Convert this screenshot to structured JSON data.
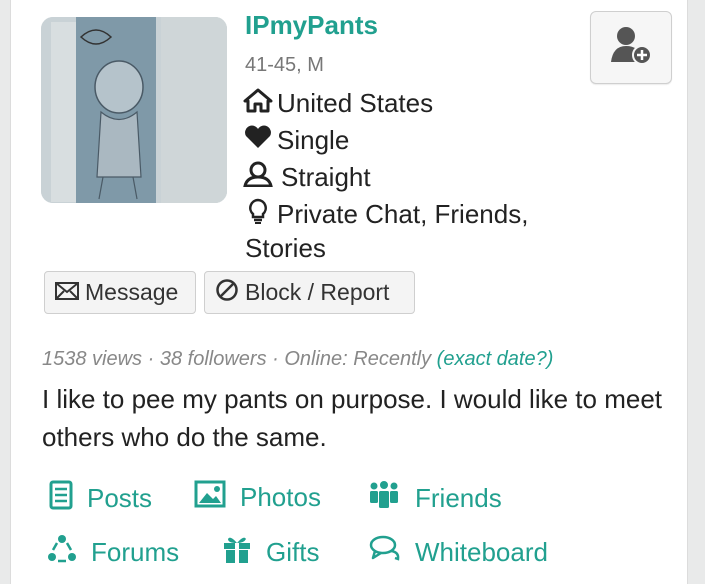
{
  "profile": {
    "username": "IPmyPants",
    "age_gender": "41-45, M",
    "location": "United States",
    "relationship": "Single",
    "orientation": "Straight",
    "looking_for_line1": "Private Chat, Friends,",
    "looking_for_line2": "Stories"
  },
  "actions": {
    "message": "Message",
    "block_report": "Block / Report"
  },
  "stats": {
    "views": "1538 views",
    "sep1": " · ",
    "followers": "38 followers",
    "sep2": " · ",
    "online": "Online: Recently",
    "exact_date": "(exact date?)"
  },
  "bio": "I like to pee my pants on purpose. I would like to meet others who do the same.",
  "nav": {
    "posts": "Posts",
    "photos": "Photos",
    "friends": "Friends",
    "forums": "Forums",
    "gifts": "Gifts",
    "whiteboard": "Whiteboard"
  },
  "colors": {
    "accent": "#21a08f",
    "muted": "#888888"
  },
  "icons": [
    "home-icon",
    "heart-icon",
    "user-icon",
    "lightbulb-icon",
    "envelope-icon",
    "ban-icon",
    "add-friend-icon",
    "posts-icon",
    "photos-icon",
    "friends-icon",
    "forums-icon",
    "gifts-icon",
    "whiteboard-icon"
  ]
}
